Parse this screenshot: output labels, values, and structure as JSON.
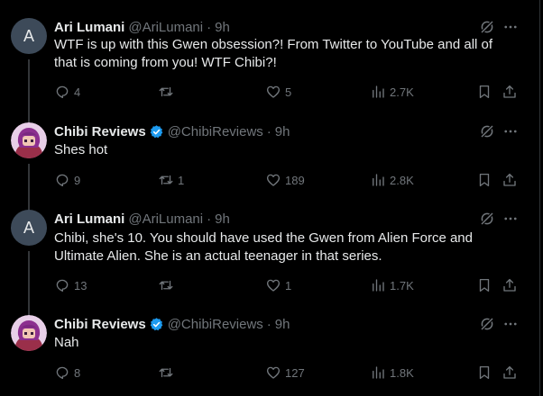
{
  "tweets": [
    {
      "display_name": "Ari Lumani",
      "handle": "@AriLumani",
      "separator": "·",
      "time": "9h",
      "avatar_letter": "A",
      "verified": false,
      "text_lines": [
        "WTF is up with this Gwen obsession?! From Twitter to YouTube and all of",
        "that is coming from you! WTF Chibi?!"
      ],
      "replies": "4",
      "retweets": "",
      "likes": "5",
      "views": "2.7K"
    },
    {
      "display_name": "Chibi Reviews",
      "handle": "@ChibiReviews",
      "separator": "·",
      "time": "9h",
      "avatar_letter": "",
      "verified": true,
      "text_lines": [
        "Shes hot"
      ],
      "replies": "9",
      "retweets": "1",
      "likes": "189",
      "views": "2.8K"
    },
    {
      "display_name": "Ari Lumani",
      "handle": "@AriLumani",
      "separator": "·",
      "time": "9h",
      "avatar_letter": "A",
      "verified": false,
      "text_lines": [
        "Chibi, she's 10. You should have used the Gwen from Alien Force and",
        "Ultimate Alien. She is an actual teenager in that series."
      ],
      "replies": "13",
      "retweets": "",
      "likes": "1",
      "views": "1.7K"
    },
    {
      "display_name": "Chibi Reviews",
      "handle": "@ChibiReviews",
      "separator": "·",
      "time": "9h",
      "avatar_letter": "",
      "verified": true,
      "text_lines": [
        "Nah"
      ],
      "replies": "8",
      "retweets": "",
      "likes": "127",
      "views": "1.8K"
    }
  ],
  "icons": {
    "reply": "reply-icon",
    "retweet": "retweet-icon",
    "like": "heart-icon",
    "views": "views-icon",
    "bookmark": "bookmark-icon",
    "share": "share-icon",
    "grok": "grok-icon",
    "more": "more-icon",
    "verified": "verified-badge-icon"
  },
  "colors": {
    "background": "#000000",
    "text": "#e7e9ea",
    "muted": "#71767b",
    "verified": "#1d9bf0",
    "thread_line": "#333639"
  }
}
